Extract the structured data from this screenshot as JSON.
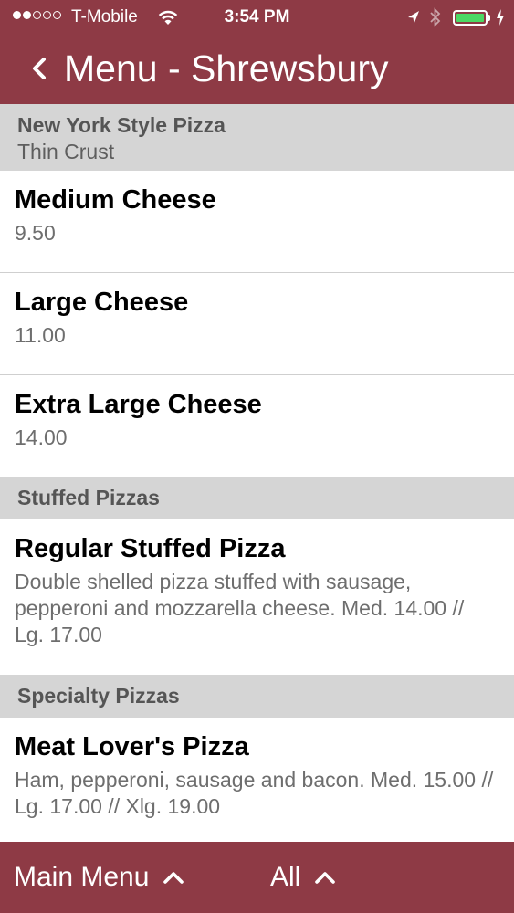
{
  "status_bar": {
    "carrier": "T-Mobile",
    "time": "3:54 PM",
    "signal_bars_filled": 2,
    "signal_bars_total": 5,
    "battery_color": "#4cd964",
    "icons": [
      "wifi-icon",
      "location-arrow-icon",
      "bluetooth-icon",
      "battery-icon",
      "charging-bolt-icon"
    ]
  },
  "nav": {
    "back_icon": "chevron-left-icon",
    "title": "Menu - Shrewsbury"
  },
  "sections": [
    {
      "title": "New York Style Pizza",
      "subtitle": "Thin Crust",
      "items": [
        {
          "name": "Medium Cheese",
          "desc": "9.50"
        },
        {
          "name": "Large Cheese",
          "desc": "11.00"
        },
        {
          "name": "Extra Large Cheese",
          "desc": "14.00"
        }
      ]
    },
    {
      "title": "Stuffed Pizzas",
      "items": [
        {
          "name": "Regular Stuffed Pizza",
          "desc": "Double shelled pizza stuffed with sausage, pepperoni and mozzarella cheese. Med. 14.00 // Lg. 17.00"
        }
      ]
    },
    {
      "title": "Specialty Pizzas",
      "items": [
        {
          "name": "Meat Lover's Pizza",
          "desc": "Ham, pepperoni, sausage and bacon. Med. 15.00 // Lg. 17.00 // Xlg. 19.00"
        }
      ]
    }
  ],
  "bottom_bar": {
    "main_menu_label": "Main Menu",
    "all_label": "All",
    "chevron_icon": "chevron-up-icon"
  },
  "colors": {
    "brand": "#8e3a45",
    "section_header_bg": "#d5d5d5"
  }
}
